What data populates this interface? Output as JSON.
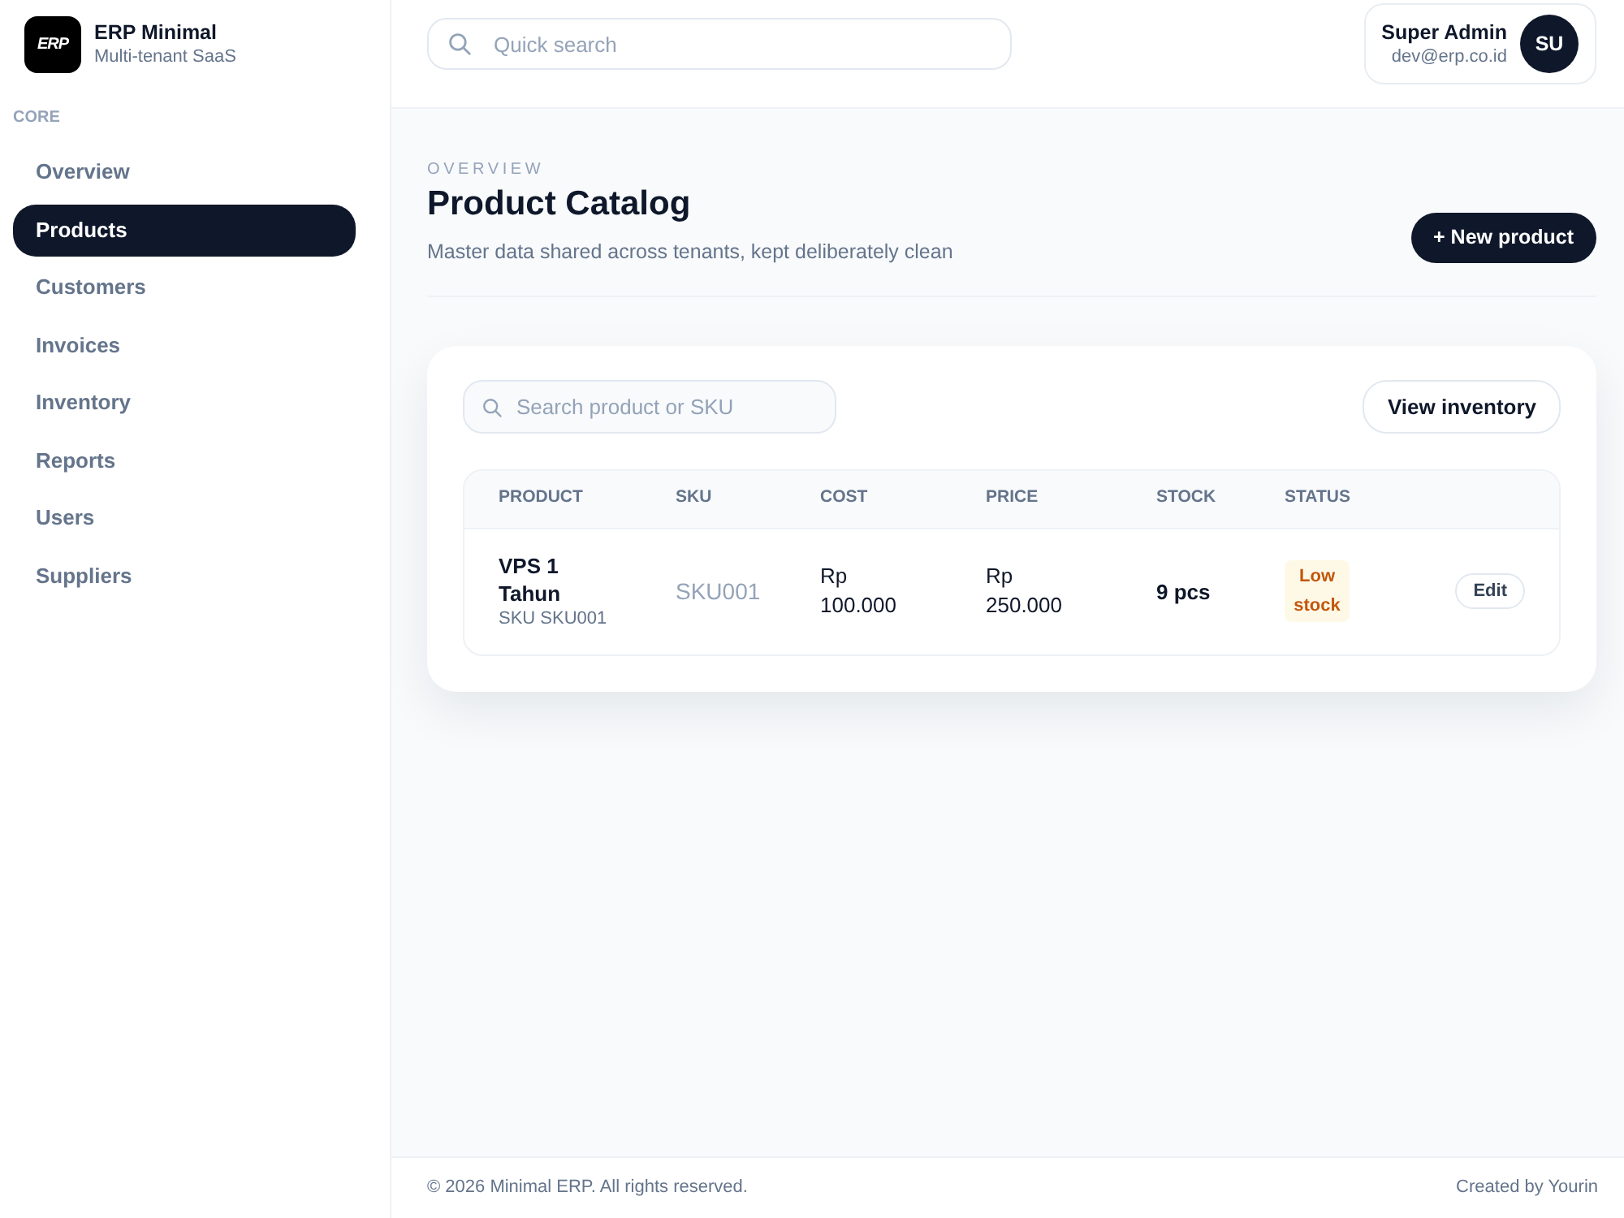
{
  "brand": {
    "logo_text": "ERP",
    "name": "ERP Minimal",
    "subtitle": "Multi-tenant SaaS"
  },
  "sidebar": {
    "section": "CORE",
    "items": [
      {
        "label": "Overview",
        "selected": false
      },
      {
        "label": "Products",
        "selected": true
      },
      {
        "label": "Customers",
        "selected": false
      },
      {
        "label": "Invoices",
        "selected": false
      },
      {
        "label": "Inventory",
        "selected": false
      },
      {
        "label": "Reports",
        "selected": false
      },
      {
        "label": "Users",
        "selected": false
      },
      {
        "label": "Suppliers",
        "selected": false
      }
    ]
  },
  "header": {
    "search": {
      "placeholder": "Quick search"
    },
    "user": {
      "name": "Super Admin",
      "email": "dev@erp.co.id",
      "initials": "SU"
    }
  },
  "page": {
    "eyebrow": "OVERVIEW",
    "title": "Product Catalog",
    "subtitle": "Master data shared across tenants, kept deliberately clean",
    "primary_action": "+ New product"
  },
  "catalog": {
    "search": {
      "placeholder": "Search product or SKU"
    },
    "secondary_action": "View inventory",
    "table": {
      "columns": [
        "PRODUCT",
        "SKU",
        "COST",
        "PRICE",
        "STOCK",
        "STATUS"
      ],
      "rows": [
        {
          "product": "VPS 1 Tahun",
          "product_sku": "SKU SKU001",
          "sku": "SKU001",
          "cost": "Rp 100.000",
          "price": "Rp 250.000",
          "stock": "9 pcs",
          "status": {
            "label": "Low stock",
            "kind": "warning"
          },
          "action": "Edit"
        }
      ]
    }
  },
  "footer": {
    "copyright": "© 2026 Minimal ERP. All rights reserved.",
    "credit": "Created by Yourin"
  }
}
